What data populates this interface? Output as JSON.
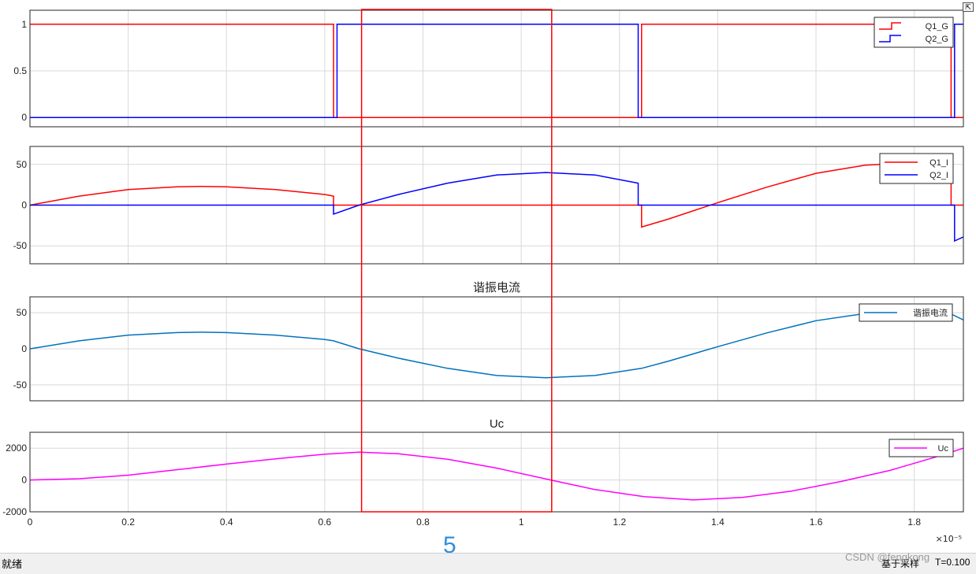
{
  "chart_data": [
    {
      "type": "line",
      "title": "",
      "xlim": [
        0,
        1.9
      ],
      "ylim": [
        -0.1,
        1.15
      ],
      "yticks": [
        0,
        0.5,
        1
      ],
      "ytick_labels": [
        "0",
        "0.5",
        "1"
      ],
      "grid": true,
      "legend": "top-right",
      "series": [
        {
          "name": "Q1_G",
          "color": "#ff0000",
          "x": [
            0,
            0.618,
            0.618,
            1.245,
            1.245,
            1.875,
            1.875,
            1.9
          ],
          "y": [
            1,
            1,
            0,
            0,
            1,
            1,
            0,
            0
          ]
        },
        {
          "name": "Q2_G",
          "color": "#0000ff",
          "x": [
            0,
            0.625,
            0.625,
            1.238,
            1.238,
            1.882,
            1.882,
            1.9
          ],
          "y": [
            0,
            0,
            1,
            1,
            0,
            0,
            1,
            1
          ]
        }
      ]
    },
    {
      "type": "line",
      "title": "",
      "xlim": [
        0,
        1.9
      ],
      "ylim": [
        -72,
        72
      ],
      "yticks": [
        -50,
        0,
        50
      ],
      "ytick_labels": [
        "-50",
        "0",
        "50"
      ],
      "grid": true,
      "legend": "top-right",
      "series": [
        {
          "name": "Q1_I",
          "color": "#ff0000",
          "x": [
            0,
            0.1,
            0.2,
            0.3,
            0.35,
            0.4,
            0.5,
            0.6,
            0.618,
            0.618,
            1.245,
            1.245,
            1.3,
            1.4,
            1.5,
            1.6,
            1.7,
            1.8,
            1.875,
            1.875,
            1.9
          ],
          "y": [
            0,
            11,
            19,
            22.5,
            23,
            22.5,
            19,
            13,
            11,
            0,
            0,
            -27,
            -17,
            3,
            22,
            39,
            49,
            52,
            52,
            0,
            0
          ]
        },
        {
          "name": "Q2_I",
          "color": "#0000ff",
          "x": [
            0,
            0.618,
            0.618,
            0.67,
            0.75,
            0.85,
            0.95,
            1.05,
            1.15,
            1.238,
            1.238,
            1.882,
            1.882,
            1.9
          ],
          "y": [
            0,
            0,
            -11,
            0,
            13,
            27,
            37,
            40,
            37,
            27,
            0,
            0,
            -44,
            -39
          ]
        }
      ]
    },
    {
      "type": "line",
      "title": "谐振电流",
      "xlim": [
        0,
        1.9
      ],
      "ylim": [
        -72,
        72
      ],
      "yticks": [
        -50,
        0,
        50
      ],
      "ytick_labels": [
        "-50",
        "0",
        "50"
      ],
      "grid": true,
      "legend": "top-right",
      "series": [
        {
          "name": "谐振电流",
          "color": "#0072bd",
          "x": [
            0,
            0.1,
            0.2,
            0.3,
            0.35,
            0.4,
            0.5,
            0.6,
            0.618,
            0.67,
            0.75,
            0.85,
            0.95,
            1.05,
            1.15,
            1.245,
            1.3,
            1.4,
            1.5,
            1.6,
            1.7,
            1.8,
            1.87,
            1.9
          ],
          "y": [
            0,
            11,
            19,
            22.5,
            23,
            22.5,
            19,
            13,
            11,
            0,
            -13,
            -27,
            -37,
            -40,
            -37,
            -27,
            -17,
            3,
            22,
            39,
            49,
            52,
            50,
            40
          ]
        }
      ]
    },
    {
      "type": "line",
      "title": "Uc",
      "xlim": [
        0,
        1.9
      ],
      "ylim": [
        -2000,
        3000
      ],
      "yticks": [
        -2000,
        0,
        2000
      ],
      "ytick_labels": [
        "-2000",
        "0",
        "2000"
      ],
      "xticks": [
        0,
        0.2,
        0.4,
        0.6,
        0.8,
        1.0,
        1.2,
        1.4,
        1.6,
        1.8
      ],
      "xtick_labels": [
        "0",
        "0.2",
        "0.4",
        "0.6",
        "0.8",
        "1",
        "1.2",
        "1.4",
        "1.6",
        "1.8"
      ],
      "x_exponent_label": "×10⁻⁵",
      "grid": true,
      "legend": "top-right",
      "series": [
        {
          "name": "Uc",
          "color": "#ff00ff",
          "x": [
            0,
            0.1,
            0.2,
            0.3,
            0.4,
            0.5,
            0.6,
            0.67,
            0.75,
            0.85,
            0.95,
            1.06,
            1.15,
            1.25,
            1.35,
            1.45,
            1.55,
            1.65,
            1.75,
            1.85,
            1.9
          ],
          "y": [
            0,
            80,
            300,
            650,
            1000,
            1330,
            1620,
            1750,
            1650,
            1300,
            750,
            0,
            -600,
            -1050,
            -1250,
            -1100,
            -700,
            -100,
            600,
            1500,
            2000
          ]
        }
      ]
    }
  ],
  "annotation": {
    "label": "5"
  },
  "statusbar": {
    "left": "就绪",
    "mid": "基于采样",
    "time": "T=0.100",
    "watermark": "CSDN @fengkong"
  },
  "colors": {
    "highlight_box": "#ff0000",
    "annotation": "#2f8fdc"
  }
}
